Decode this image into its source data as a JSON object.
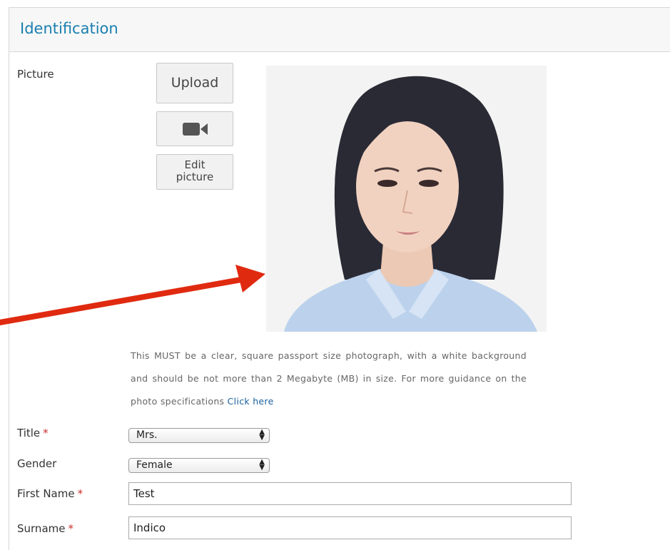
{
  "panel": {
    "title": "Identification"
  },
  "picture": {
    "label": "Picture",
    "upload_label": "Upload",
    "camera_icon": "video-camera-icon",
    "edit_label_line1": "Edit",
    "edit_label_line2": "picture"
  },
  "guidance": {
    "text": "This MUST be a clear, square passport size photograph, with a white background and should be not more than 2 Megabyte (MB) in size. For more guidance on the photo specifications",
    "link": "Click here"
  },
  "fields": {
    "title": {
      "label": "Title",
      "required": "*",
      "value": "Mrs."
    },
    "gender": {
      "label": "Gender",
      "value": "Female"
    },
    "first_name": {
      "label": "First Name",
      "required": "*",
      "value": "Test"
    },
    "surname": {
      "label": "Surname",
      "required": "*",
      "value": "Indico"
    }
  },
  "colors": {
    "accent": "#1a7fb0",
    "required": "#c9302c",
    "annotation_arrow": "#e02a10"
  }
}
